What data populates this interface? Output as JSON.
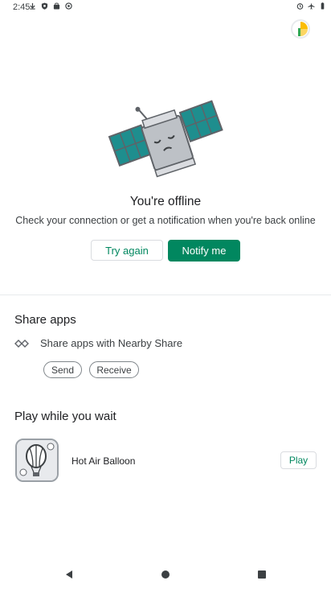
{
  "status_bar": {
    "time": "2:45",
    "left_icons": [
      "download-icon",
      "shield-icon",
      "bag-icon",
      "sync-icon"
    ],
    "right_icons": [
      "alarm-icon",
      "airplane-icon",
      "battery-icon"
    ]
  },
  "offline": {
    "title": "You're offline",
    "subtitle": "Check your connection or get a notification when you're back online",
    "try_again_label": "Try again",
    "notify_label": "Notify me"
  },
  "share": {
    "title": "Share apps",
    "nearby_label": "Share apps with Nearby Share",
    "send_label": "Send",
    "receive_label": "Receive"
  },
  "play": {
    "title": "Play while you wait",
    "game_name": "Hot Air Balloon",
    "play_label": "Play"
  },
  "colors": {
    "accent": "#01875f"
  }
}
